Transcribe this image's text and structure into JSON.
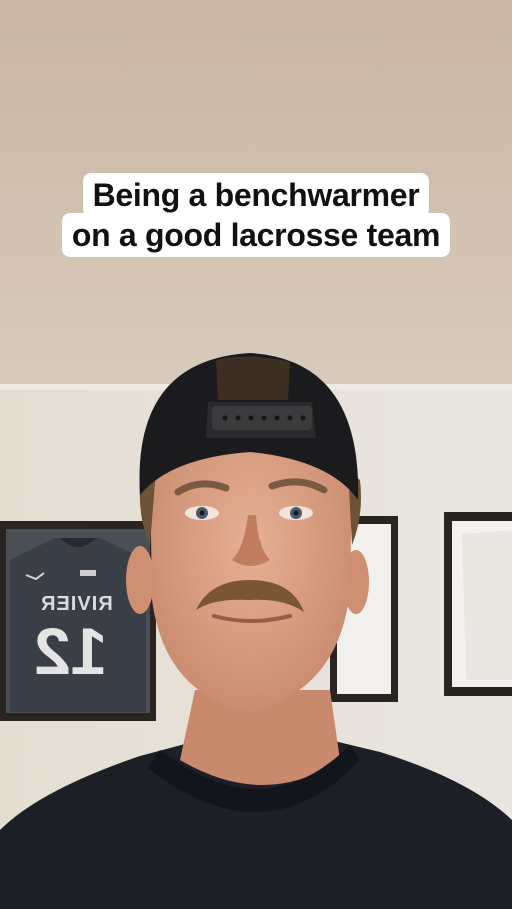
{
  "caption": {
    "line1": "Being a benchwarmer",
    "line2": "on a good lacrosse team"
  },
  "jersey": {
    "name": "RIVIER",
    "number": "12"
  },
  "colors": {
    "ceiling": "#c9b8a6",
    "wall": "#e6e2dc",
    "frame": "#2a2420",
    "jersey": "#3a3f47",
    "cap": "#1b1b1d",
    "shirt": "#1c1f26",
    "skin": "#dca085"
  }
}
